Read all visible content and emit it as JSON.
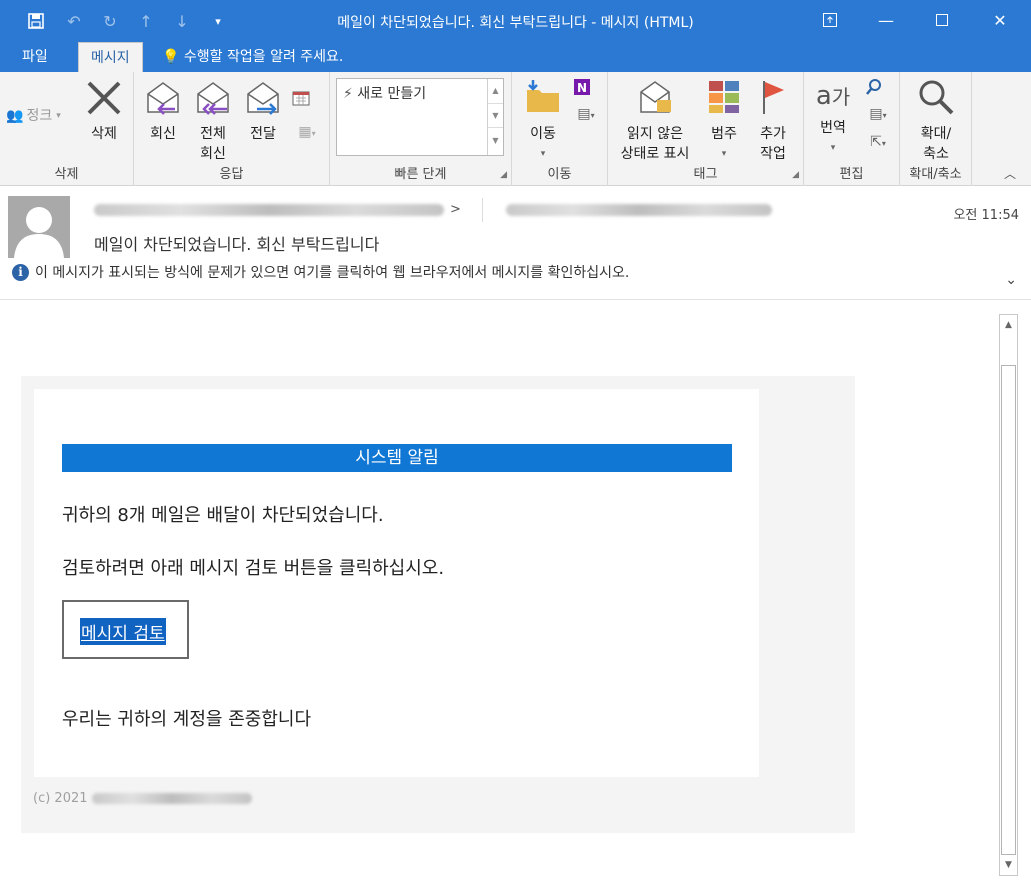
{
  "window": {
    "title": "메일이 차단되었습니다. 회신 부탁드립니다 - 메시지 (HTML)"
  },
  "tabs": {
    "file": "파일",
    "message": "메시지",
    "tell_me": "수행할 작업을 알려 주세요."
  },
  "ribbon": {
    "delete_group": {
      "label": "삭제",
      "junk": "정크",
      "delete": "삭제"
    },
    "respond_group": {
      "label": "응답",
      "reply": "회신",
      "reply_all_line1": "전체",
      "reply_all_line2": "회신",
      "forward": "전달"
    },
    "quick_steps_group": {
      "label": "빠른 단계",
      "new": "새로 만들기"
    },
    "move_group": {
      "label": "이동",
      "move": "이동"
    },
    "tags_group": {
      "label": "태그",
      "mark_unread_line1": "읽지 않은",
      "mark_unread_line2": "상태로 표시",
      "categorize": "범주",
      "follow_up_line1": "추가",
      "follow_up_line2": "작업"
    },
    "editing_group": {
      "label": "편집",
      "translate": "번역"
    },
    "zoom_group": {
      "label": "확대/축소",
      "zoom_line1": "확대/",
      "zoom_line2": "축소"
    }
  },
  "header": {
    "time": "오전 11:54",
    "subject": "메일이 차단되었습니다. 회신 부탁드립니다",
    "info": "이 메시지가 표시되는 방식에 문제가 있으면 여기를 클릭하여 웹 브라우저에서 메시지를 확인하십시오."
  },
  "email": {
    "banner": "시스템 알림",
    "line1": "귀하의 8개 메일은 배달이 차단되었습니다.",
    "line2": "검토하려면 아래 메시지 검토 버튼을 클릭하십시오.",
    "review_link": "메시지 검토",
    "closing": "우리는 귀하의 계정을 존중합니다",
    "footer": "(c) 2021"
  },
  "colors": {
    "titlebar": "#2b79d2",
    "banner": "#1177d4",
    "link_bg": "#1063c1"
  }
}
